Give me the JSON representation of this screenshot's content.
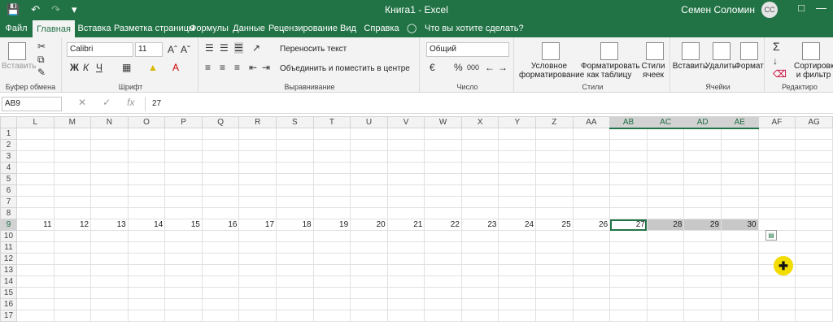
{
  "titlebar": {
    "doc_title": "Книга1  -  Excel",
    "user_name": "Семен Соломин",
    "user_initials": "СС",
    "qat": [
      "save-icon",
      "undo-icon",
      "redo-icon",
      "customize-icon"
    ]
  },
  "tabs": [
    {
      "label": "Файл"
    },
    {
      "label": "Главная"
    },
    {
      "label": "Вставка"
    },
    {
      "label": "Разметка страницы"
    },
    {
      "label": "Формулы"
    },
    {
      "label": "Данные"
    },
    {
      "label": "Рецензирование"
    },
    {
      "label": "Вид"
    },
    {
      "label": "Справка"
    }
  ],
  "tell_me": "Что вы хотите сделать?",
  "ribbon": {
    "clipboard": {
      "paste": "Вставить",
      "label": "Буфер обмена"
    },
    "font": {
      "name": "Calibri",
      "size": "11",
      "bold": "Ж",
      "italic": "К",
      "underline": "Ч",
      "label": "Шрифт"
    },
    "alignment": {
      "wrap": "Переносить текст",
      "merge": "Объединить и поместить в центре",
      "label": "Выравнивание"
    },
    "number": {
      "format": "Общий",
      "percent": "%",
      "thousands": "000",
      "label": "Число"
    },
    "styles": {
      "conditional": "Условное форматирование",
      "as_table": "Форматировать как таблицу",
      "cell_styles": "Стили ячеек",
      "label": "Стили"
    },
    "cells": {
      "insert": "Вставить",
      "delete": "Удалить",
      "format": "Формат",
      "label": "Ячейки"
    },
    "editing": {
      "sum": "Σ",
      "sort": "Сортировка и фильтр",
      "label": "Редактиро"
    }
  },
  "formula_bar": {
    "name_box": "AB9",
    "fx": "fx",
    "value": "27"
  },
  "columns": [
    "L",
    "M",
    "N",
    "O",
    "P",
    "Q",
    "R",
    "S",
    "T",
    "U",
    "V",
    "W",
    "X",
    "Y",
    "Z",
    "AA",
    "AB",
    "AC",
    "AD",
    "AE",
    "AF",
    "AG"
  ],
  "selected_columns": [
    "AB",
    "AC",
    "AD",
    "AE"
  ],
  "rows": [
    "1",
    "2",
    "3",
    "4",
    "5",
    "6",
    "7",
    "8",
    "9",
    "10",
    "11",
    "12",
    "13",
    "14",
    "15",
    "16",
    "17"
  ],
  "row9_values": [
    "11",
    "12",
    "13",
    "14",
    "15",
    "16",
    "17",
    "18",
    "19",
    "20",
    "21",
    "22",
    "23",
    "24",
    "25",
    "26",
    "27",
    "28",
    "29",
    "30"
  ]
}
